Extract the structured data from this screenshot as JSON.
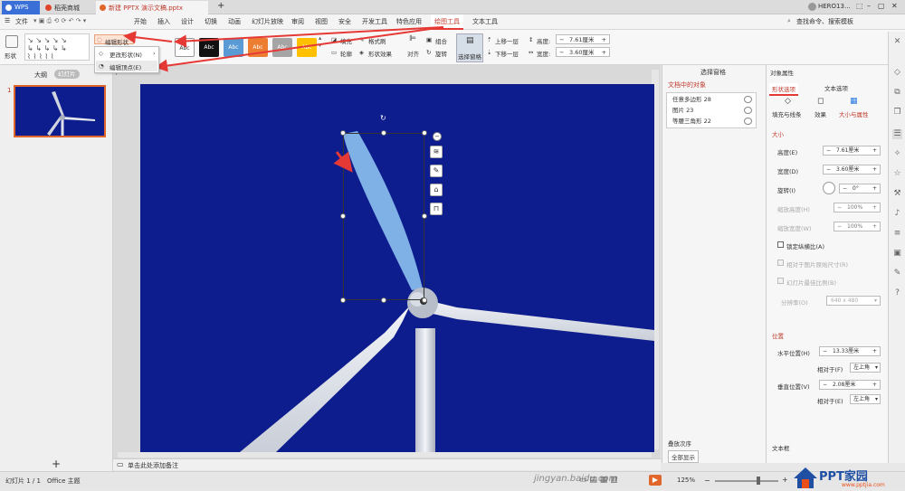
{
  "tabs": [
    {
      "label": "WPS",
      "color": "#2a7ae2"
    },
    {
      "label": "稻壳商城",
      "color": "#e0452b"
    },
    {
      "label": "新建 PPTX 演示文稿.pptx",
      "color": "#e0662b"
    }
  ],
  "titlebar": {
    "new_tab": "+",
    "user": "HERO13...",
    "window_controls": [
      "⬚",
      "–",
      "▢",
      "✕"
    ]
  },
  "menu": {
    "file": "文件",
    "items": [
      "开始",
      "插入",
      "设计",
      "切换",
      "动画",
      "幻灯片放映",
      "审阅",
      "视图",
      "安全",
      "开发工具",
      "特色应用",
      "绘图工具",
      "文本工具"
    ],
    "active": "绘图工具",
    "search": "查找命令、搜索模板"
  },
  "ribbon": {
    "shape_label": "形状",
    "edit_shape": "编辑形状",
    "change_shape": "更改形状(N)",
    "edit_vertex": "编辑顶点(E)",
    "styles": [
      "Abc",
      "Abc",
      "Abc",
      "Abc",
      "Abc",
      "Abc"
    ],
    "style_colors": [
      "#ffffff",
      "#111111",
      "#5b9bd5",
      "#ed7d31",
      "#a5a5a5",
      "#ffc000"
    ],
    "fill": "填充",
    "outline": "轮廓",
    "format_painter": "格式刷",
    "shape_effect": "形状效果",
    "align": "对齐",
    "group": "组合",
    "rotate": "旋转",
    "selection_pane": "选择窗格",
    "bring_forward": "上移一层",
    "send_backward": "下移一层",
    "height_label": "高度:",
    "height_value": "7.61厘米",
    "width_label": "宽度:",
    "width_value": "3.60厘米"
  },
  "leftpanel": {
    "tab_outline": "大纲",
    "tab_slides": "幻灯片",
    "slide_number": "1",
    "add": "+"
  },
  "selection_pane": {
    "title": "选择窗格",
    "section": "文档中的对象",
    "objects": [
      "任意多边形 28",
      "图片 23",
      "等腰三角形 22"
    ],
    "order_label": "叠放次序",
    "show_all": "全部显示"
  },
  "properties": {
    "title": "对象属性",
    "tab_shape": "形状选项",
    "tab_text": "文本选项",
    "sub_fill": "填充与线条",
    "sub_effect": "效果",
    "sub_size": "大小与属性",
    "size_section": "大小",
    "height_label": "高度(E)",
    "height": "7.61厘米",
    "width_label": "宽度(D)",
    "width": "3.60厘米",
    "rotate_label": "旋转(I)",
    "rotate": "0°",
    "scale_h_label": "缩放高度(H)",
    "scale_h": "100%",
    "scale_w_label": "缩放宽度(W)",
    "scale_w": "100%",
    "lock_ratio": "锁定纵横比(A)",
    "relative_original": "相对于图片原始尺寸(R)",
    "best_scale": "幻灯片最佳比例(B)",
    "resolution_label": "分辨率(O)",
    "resolution": "640 x 480",
    "position_section": "位置",
    "hpos_label": "水平位置(H)",
    "hpos": "13.33厘米",
    "rel_label": "相对于(F)",
    "rel_value": "左上角",
    "vpos_label": "垂直位置(V)",
    "vpos": "2.08厘米",
    "rel2_label": "相对于(E)",
    "rel2_value": "左上角",
    "text_box": "文本框"
  },
  "notes": {
    "placeholder": "单击此处添加备注"
  },
  "status": {
    "slide": "幻灯片 1 / 1",
    "theme": "Office 主题",
    "zoom": "125%",
    "watermark": "jingyan.baidu.com",
    "brand": "PPT家园",
    "brand_url": "www.pptjia.com"
  },
  "annotation_color": "#e53935"
}
